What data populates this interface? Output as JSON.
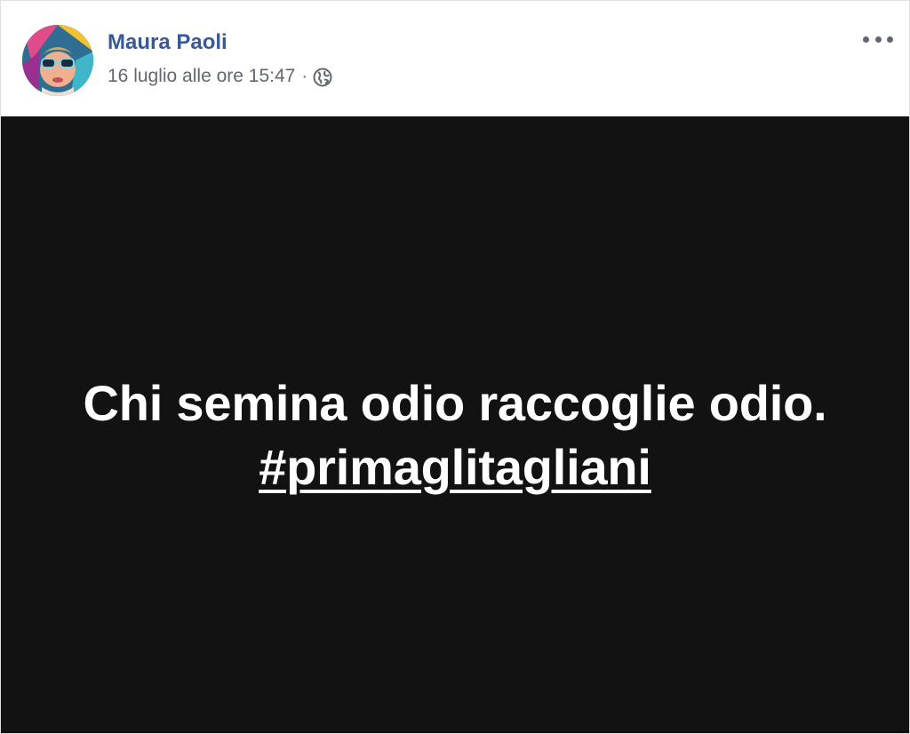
{
  "post": {
    "author": {
      "name": "Maura Paoli",
      "avatar_icon": "profile-photo"
    },
    "timestamp": "16 luglio alle ore 15:47",
    "separator": "·",
    "privacy_icon": "globe-icon",
    "more_icon": "more-options-icon",
    "content": {
      "line1": "Chi semina odio raccoglie odio.",
      "hashtag": "#primaglitagliani",
      "background_color": "#121212",
      "text_color": "#ffffff"
    }
  },
  "colors": {
    "name_link": "#385898",
    "meta_text": "#616770"
  }
}
